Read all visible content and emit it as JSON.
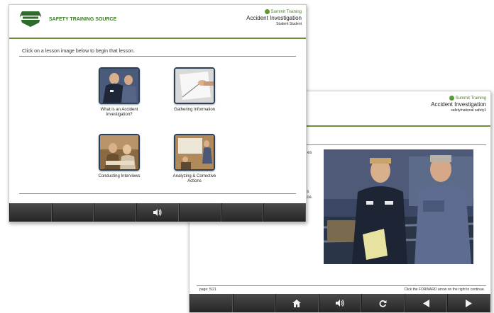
{
  "back_screen": {
    "brand": "Summit Training",
    "course_title": "Accident Investigation",
    "user_name": "safety/national safety1",
    "partial_text_lines": [
      "es",
      "ds",
      "nce."
    ],
    "footer_left": "page: 5/21",
    "footer_right": "Click the FORWARD arrow on the right to continue.",
    "toolbar": [
      "",
      "",
      "home-icon",
      "audio-icon",
      "reload-icon",
      "back-arrow-icon",
      "forward-arrow-icon"
    ]
  },
  "front_screen": {
    "logo_text": "SAFETY TRAINING SOURCE",
    "brand": "Summit Training",
    "course_title": "Accident Investigation",
    "user_name": "Student Student",
    "instruction": "Click on a lesson image below to begin that lesson.",
    "lessons": [
      {
        "caption": "What is an Accident Investigation?",
        "icon": "workers-icon"
      },
      {
        "caption": "Gathering Information",
        "icon": "writing-icon"
      },
      {
        "caption": "Conducting Interviews",
        "icon": "interview-icon"
      },
      {
        "caption": "Analyzing & Corrective Actions",
        "icon": "presentation-icon"
      }
    ],
    "toolbar": [
      "",
      "",
      "",
      "audio-icon",
      "",
      "",
      ""
    ]
  },
  "colors": {
    "accent_green": "#4a7d2a",
    "toolbar_dark": "#2e2e2e",
    "thumb_border": "#2b3f57"
  }
}
